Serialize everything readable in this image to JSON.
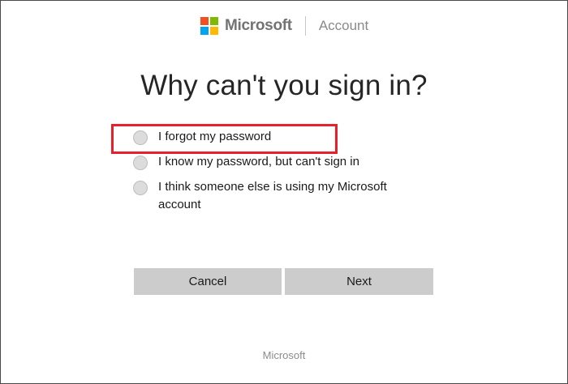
{
  "header": {
    "brand_name": "Microsoft",
    "section_name": "Account",
    "logo_colors": [
      "#f25022",
      "#7fba00",
      "#00a4ef",
      "#ffb900"
    ]
  },
  "page_title": "Why can't you sign in?",
  "options": [
    {
      "label": "I forgot my password",
      "selected": false,
      "highlighted": true
    },
    {
      "label": "I know my password, but can't sign in",
      "selected": false
    },
    {
      "label": "I think someone else is using my Microsoft account",
      "selected": false
    }
  ],
  "buttons": {
    "cancel_label": "Cancel",
    "next_label": "Next"
  },
  "footer": {
    "text": "Microsoft"
  },
  "colors": {
    "highlight_border": "#e8202b",
    "button_bg": "#cccccc"
  }
}
